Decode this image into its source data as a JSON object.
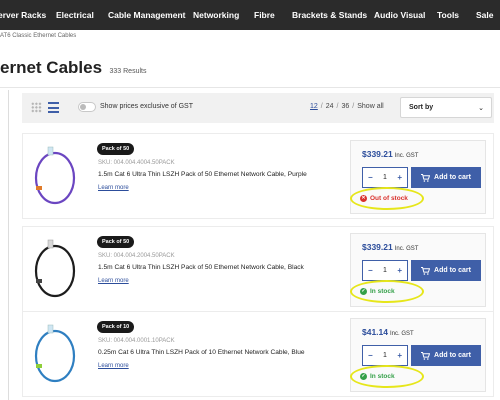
{
  "nav": {
    "items": [
      "erver Racks",
      "Electrical",
      "Cable Management",
      "Networking",
      "Fibre",
      "Brackets & Stands",
      "Audio Visual",
      "Tools",
      "Sale"
    ]
  },
  "breadcrumb": "AT6 Classic Ethernet Cables",
  "page": {
    "title": "ernet Cables",
    "results": "333 Results"
  },
  "toolbar": {
    "gst_label": "Show prices exclusive of GST",
    "page_sizes": [
      "12",
      "24",
      "36",
      "Show all"
    ],
    "separator": "/",
    "sort_label": "Sort by",
    "sort_chevron": "⌄"
  },
  "products": [
    {
      "badge": "Pack of 50",
      "sku": "SKU: 004.004.4004.50PACK",
      "name": "1.5m Cat 6 Ultra Thin LSZH Pack of 50 Ethernet Network Cable, Purple",
      "learn_more": "Learn more",
      "price": "$339.21",
      "price_suffix": "Inc. GST",
      "qty": "1",
      "minus": "−",
      "plus": "+",
      "add_label": "Add to cart",
      "stock": "Out of stock",
      "stock_icon": "✕",
      "cable_color": "#6b46c1"
    },
    {
      "badge": "Pack of 50",
      "sku": "SKU: 004.004.2004.50PACK",
      "name": "1.5m Cat 6 Ultra Thin LSZH Pack of 50 Ethernet Network Cable, Black",
      "learn_more": "Learn more",
      "price": "$339.21",
      "price_suffix": "Inc. GST",
      "qty": "1",
      "minus": "−",
      "plus": "+",
      "add_label": "Add to cart",
      "stock": "In stock",
      "stock_icon": "✓",
      "cable_color": "#1d1d1d"
    },
    {
      "badge": "Pack of 10",
      "sku": "SKU: 004.004.0001.10PACK",
      "name": "0.25m Cat 6 Ultra Thin LSZH Pack of 10 Ethernet Network Cable, Blue",
      "learn_more": "Learn more",
      "price": "$41.14",
      "price_suffix": "Inc. GST",
      "qty": "1",
      "minus": "−",
      "plus": "+",
      "add_label": "Add to cart",
      "stock": "In stock",
      "stock_icon": "✓",
      "cable_color": "#2f7fc1"
    }
  ],
  "colors": {
    "nav_bg": "#2b2b2b",
    "accent": "#3f5fa8",
    "price": "#2c4d9b",
    "out_of_stock": "#d9302b",
    "in_stock": "#34a048",
    "highlight_ring": "#e6e61a"
  }
}
